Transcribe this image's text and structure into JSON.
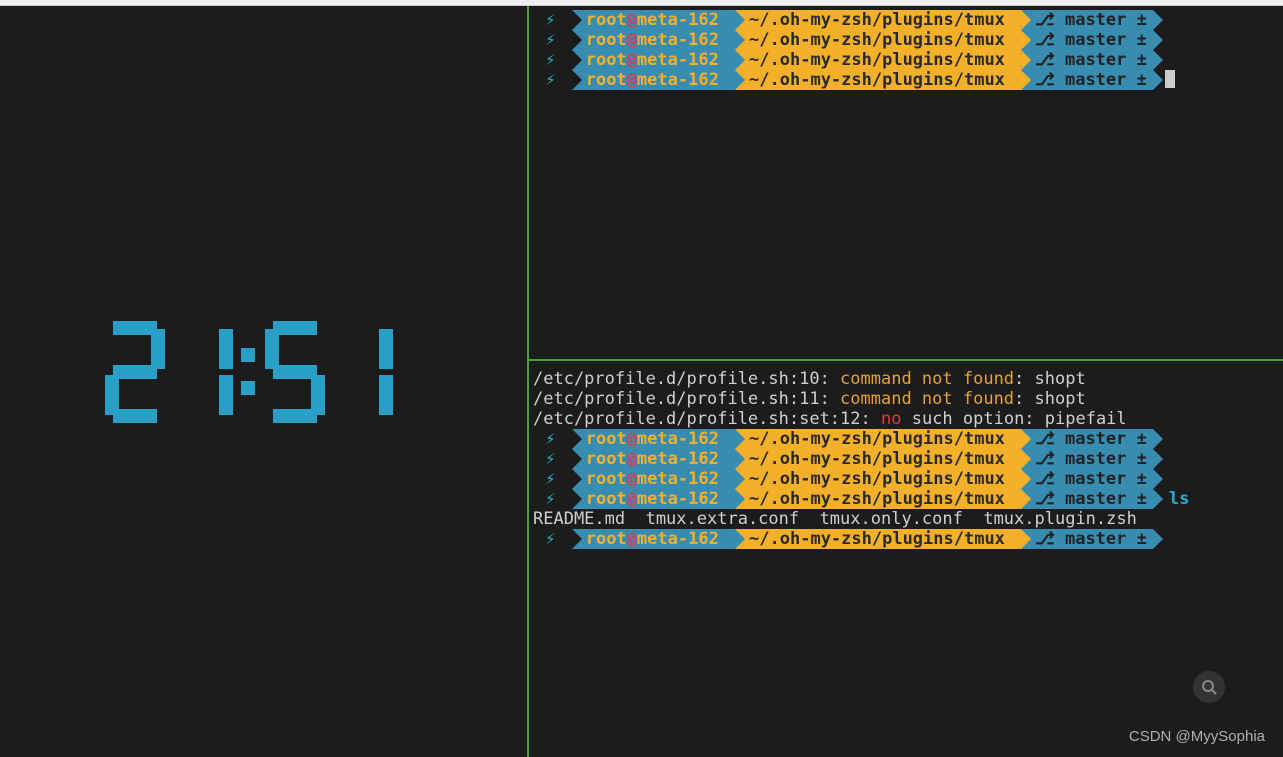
{
  "clock": {
    "time": "21:51",
    "d1": "2",
    "d2": "1",
    "d3": "5",
    "d4": "1"
  },
  "prompt": {
    "bolt": "⚡",
    "user": "root",
    "at": "@",
    "host": "meta-162",
    "path": "~/.oh-my-zsh/plugins/tmux",
    "branch_icon": "⎇",
    "branch": " master ±"
  },
  "top_pane": {
    "prompt_count": 4
  },
  "bottom_pane": {
    "errors": [
      {
        "prefix": "/etc/profile.d/profile.sh:10: ",
        "highlight": "command not found",
        "suffix": ": shopt"
      },
      {
        "prefix": "/etc/profile.d/profile.sh:11: ",
        "highlight": "command not found",
        "suffix": ": shopt"
      },
      {
        "prefix": "/etc/profile.d/profile.sh:set:12: ",
        "highlight": "no",
        "suffix": " such option: pipefail",
        "red": true
      }
    ],
    "prompts_before_ls": 3,
    "ls_command": "ls",
    "ls_output": "README.md  tmux.extra.conf  tmux.only.conf  tmux.plugin.zsh"
  },
  "watermark": "CSDN @MyySophia",
  "search_icon": "🔍"
}
